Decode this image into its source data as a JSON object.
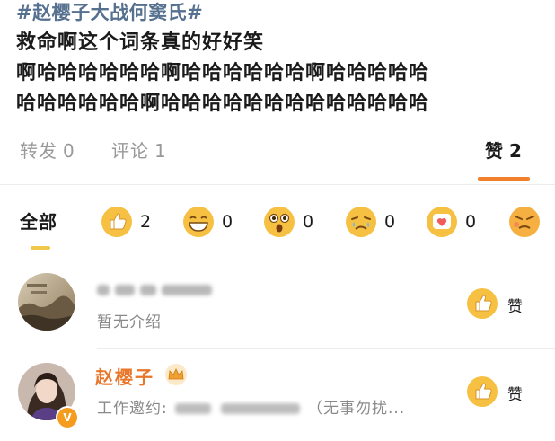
{
  "post": {
    "hashtag": "#赵樱子大战何窦氏#",
    "lines": [
      "救命啊这个词条真的好好笑",
      "啊哈哈哈哈哈哈啊哈哈哈哈哈哈啊哈哈哈哈哈",
      "哈哈哈哈哈哈啊哈哈哈哈哈哈哈哈哈哈哈哈哈"
    ]
  },
  "tabs": {
    "repost": {
      "label": "转发",
      "count": "0"
    },
    "comment": {
      "label": "评论",
      "count": "1"
    },
    "like": {
      "label": "赞",
      "count": "2"
    }
  },
  "reactions": {
    "all_label": "全部",
    "items": [
      {
        "icon": "thumbs-up-icon",
        "count": "2"
      },
      {
        "icon": "laughing-face-icon",
        "count": "0"
      },
      {
        "icon": "surprised-face-icon",
        "count": "0"
      },
      {
        "icon": "crying-face-icon",
        "count": "0"
      },
      {
        "icon": "heart-icon",
        "count": "0"
      },
      {
        "icon": "angry-face-icon"
      }
    ]
  },
  "users": [
    {
      "intro": "暂无介绍",
      "like_label": "赞"
    },
    {
      "name": "赵樱子",
      "work_prefix": "工作邀约:",
      "work_suffix": "（无事勿扰...",
      "like_label": "赞"
    }
  ],
  "colors": {
    "accent": "#f0812a",
    "hashtag": "#56708f",
    "username": "#e8762b",
    "emoji": "#f6c142"
  }
}
